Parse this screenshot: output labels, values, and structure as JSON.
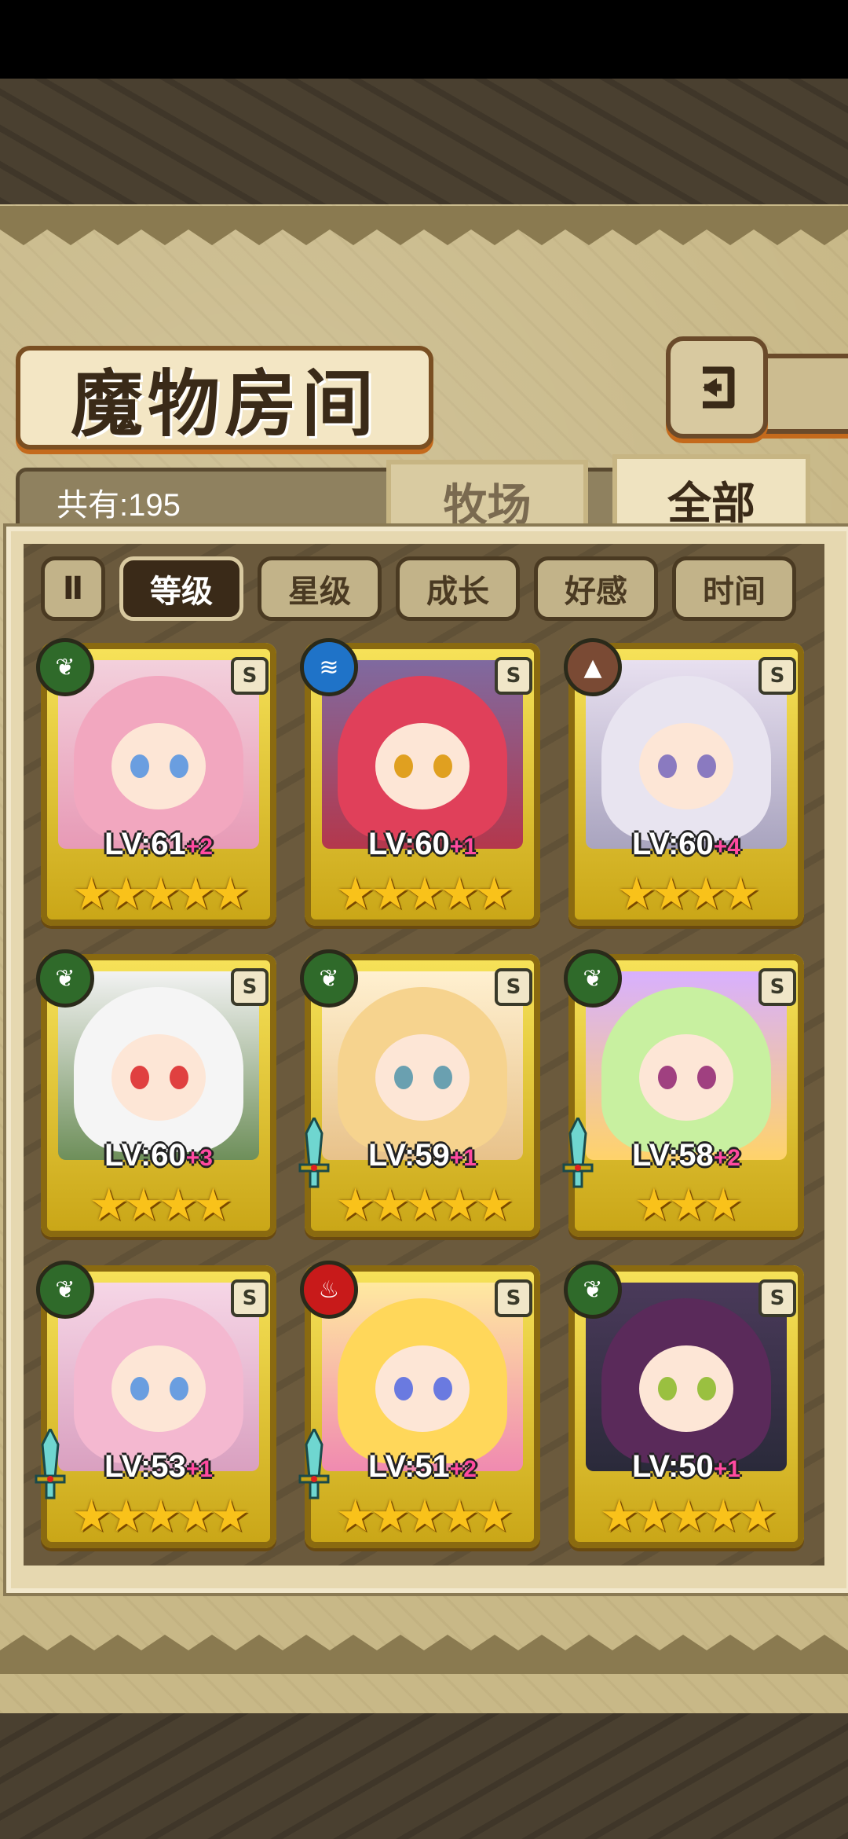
{
  "title": "魔物房间",
  "count_label": "共有:195",
  "tabs": [
    {
      "label": "牧场"
    },
    {
      "label": "全部"
    }
  ],
  "sort": {
    "toggle_label": "Ⅱ",
    "buttons": [
      {
        "label": "等级",
        "active": true
      },
      {
        "label": "星级",
        "active": false
      },
      {
        "label": "成长",
        "active": false
      },
      {
        "label": "好感",
        "active": false
      },
      {
        "label": "时间",
        "active": false
      }
    ]
  },
  "monsters": [
    {
      "element": "grass",
      "rank": "S",
      "level": "LV:61",
      "plus": "+2",
      "stars": "★★★★★",
      "weapon": false
    },
    {
      "element": "water",
      "rank": "S",
      "level": "LV:60",
      "plus": "+1",
      "stars": "★★★★★",
      "weapon": false
    },
    {
      "element": "earth",
      "rank": "S",
      "level": "LV:60",
      "plus": "+4",
      "stars": "★★★★",
      "weapon": false
    },
    {
      "element": "grass",
      "rank": "S",
      "level": "LV:60",
      "plus": "+3",
      "stars": "★★★★",
      "weapon": false
    },
    {
      "element": "grass",
      "rank": "S",
      "level": "LV:59",
      "plus": "+1",
      "stars": "★★★★★",
      "weapon": true
    },
    {
      "element": "grass",
      "rank": "S",
      "level": "LV:58",
      "plus": "+2",
      "stars": "★★★",
      "weapon": true
    },
    {
      "element": "grass",
      "rank": "S",
      "level": "LV:53",
      "plus": "+1",
      "stars": "★★★★★",
      "weapon": true
    },
    {
      "element": "fire",
      "rank": "S",
      "level": "LV:51",
      "plus": "+2",
      "stars": "★★★★★",
      "weapon": true
    },
    {
      "element": "grass",
      "rank": "S",
      "level": "LV:50",
      "plus": "+1",
      "stars": "★★★★★",
      "weapon": false
    }
  ],
  "colors": {
    "grass": "#2f6a2a",
    "water": "#1f73c8",
    "earth": "#7a4a34",
    "fire": "#c81a1a",
    "frame_gold": "#f7e35a",
    "star": "#f9c21a",
    "plus": "#ff4aa0"
  }
}
